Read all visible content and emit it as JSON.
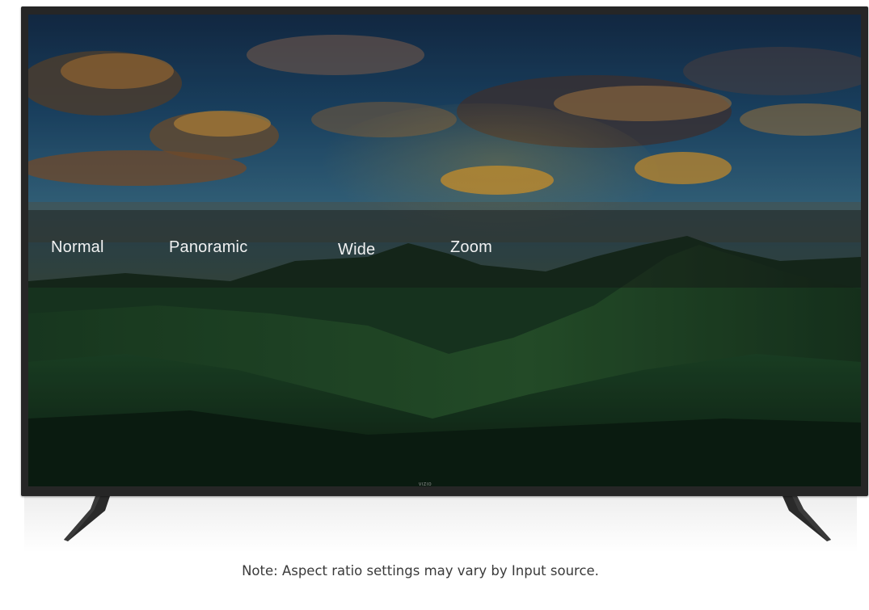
{
  "tv": {
    "brand_logo": "VIZIO",
    "aspect_ratio_menu": {
      "options": [
        {
          "label": "Normal"
        },
        {
          "label": "Panoramic"
        },
        {
          "label": "Wide"
        },
        {
          "label": "Zoom"
        }
      ]
    }
  },
  "note": {
    "text": "Note: Aspect ratio settings may vary by Input source."
  },
  "colors": {
    "bezel": "#262626",
    "menu_text": "#f1f1f1",
    "note_text": "#3a3a3a"
  }
}
